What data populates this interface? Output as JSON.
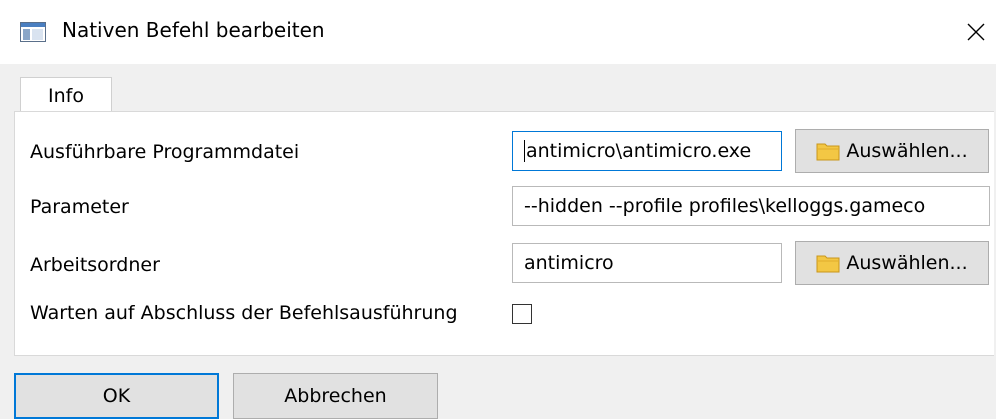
{
  "window": {
    "title": "Nativen Befehl bearbeiten",
    "app_icon": "window-app-icon",
    "close_icon": "close-icon"
  },
  "tabs": [
    {
      "label": "Info",
      "active": true
    }
  ],
  "form": {
    "executable": {
      "label": "Ausführbare Programmdatei",
      "value": "antimicro\\antimicro.exe",
      "browse_label": "Auswählen..."
    },
    "parameters": {
      "label": "Parameter",
      "value": "--hidden --profile profiles\\kelloggs.gameco"
    },
    "working_dir": {
      "label": "Arbeitsordner",
      "value": "antimicro",
      "browse_label": "Auswählen..."
    },
    "wait": {
      "label": "Warten auf Abschluss der Befehlsausführung",
      "checked": false
    }
  },
  "buttons": {
    "ok": "OK",
    "cancel": "Abbrechen"
  },
  "colors": {
    "accent": "#0078d7",
    "background": "#f0f0f0",
    "folder": "#f3c744"
  }
}
